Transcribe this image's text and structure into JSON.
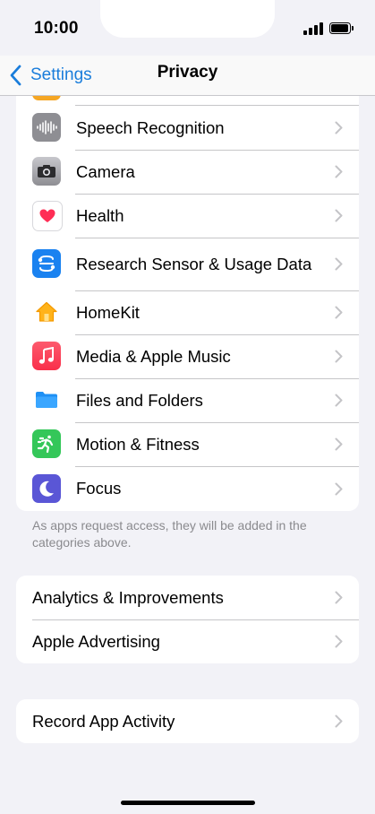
{
  "status_bar": {
    "time": "10:00"
  },
  "nav": {
    "back_label": "Settings",
    "title": "Privacy"
  },
  "privacy_items": [
    {
      "label": "Speech Recognition",
      "icon": "waveform-icon",
      "color": "#8e8e93"
    },
    {
      "label": "Camera",
      "icon": "camera-icon",
      "color": "#8e8e93"
    },
    {
      "label": "Health",
      "icon": "heart-icon",
      "color": "#ffffff"
    },
    {
      "label": "Research Sensor & Usage Data",
      "icon": "research-icon",
      "color": "#1a82f0"
    },
    {
      "label": "HomeKit",
      "icon": "home-icon",
      "color": "#ffffff"
    },
    {
      "label": "Media & Apple Music",
      "icon": "music-note-icon",
      "color": "#fa3c51"
    },
    {
      "label": "Files and Folders",
      "icon": "folder-icon",
      "color": "#ffffff"
    },
    {
      "label": "Motion & Fitness",
      "icon": "running-figure-icon",
      "color": "#34c759"
    },
    {
      "label": "Focus",
      "icon": "moon-icon",
      "color": "#5a56d6"
    }
  ],
  "footnote": "As apps request access, they will be added in the categories above.",
  "analytics_group": [
    {
      "label": "Analytics & Improvements"
    },
    {
      "label": "Apple Advertising"
    }
  ],
  "activity_group": [
    {
      "label": "Record App Activity"
    }
  ]
}
